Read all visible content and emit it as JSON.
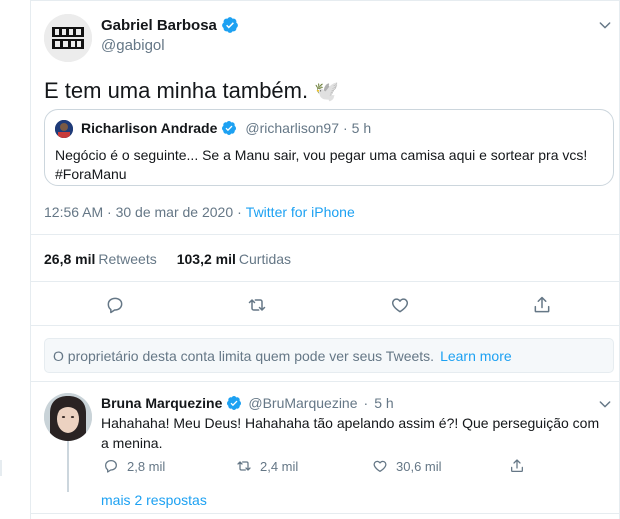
{
  "tweet": {
    "author_name": "Gabriel Barbosa",
    "author_handle": "@gabigol",
    "avatar_text": "GABI GOL",
    "text": "E tem uma minha também.",
    "emoji": "🕊️",
    "quote": {
      "author_name": "Richarlison Andrade",
      "author_handle": "@richarlison97",
      "dot": "·",
      "time": "5 h",
      "text": "Negócio é o seguinte... Se a Manu sair, vou pegar uma camisa aqui e sortear pra vcs!",
      "hashtag": "#ForaManu"
    },
    "timestamp": "12:56 AM · 30 de mar de 2020",
    "dot": "·",
    "source": "Twitter for iPhone",
    "retweets_count": "26,8 mil",
    "retweets_label": "Retweets",
    "likes_count": "103,2 mil",
    "likes_label": "Curtidas"
  },
  "notice": {
    "text": "O proprietário desta conta limita quem pode ver seus Tweets.",
    "link": "Learn more"
  },
  "reply": {
    "author_name": "Bruna Marquezine",
    "author_handle": "@BruMarquezine",
    "dot": "·",
    "time": "5 h",
    "text": "Hahahaha! Meu Deus! Hahahaha tão apelando assim é?! Que perseguição com a menina.",
    "replies": "2,8 mil",
    "retweets": "2,4 mil",
    "likes": "30,6 mil"
  },
  "more_replies": "mais 2 respostas",
  "colors": {
    "blue": "#1da1f2",
    "gray": "#657786",
    "border": "#e6ecf0"
  },
  "icons": [
    "verified-badge-icon",
    "chevron-down-icon",
    "reply-icon",
    "retweet-icon",
    "like-icon",
    "share-icon"
  ]
}
